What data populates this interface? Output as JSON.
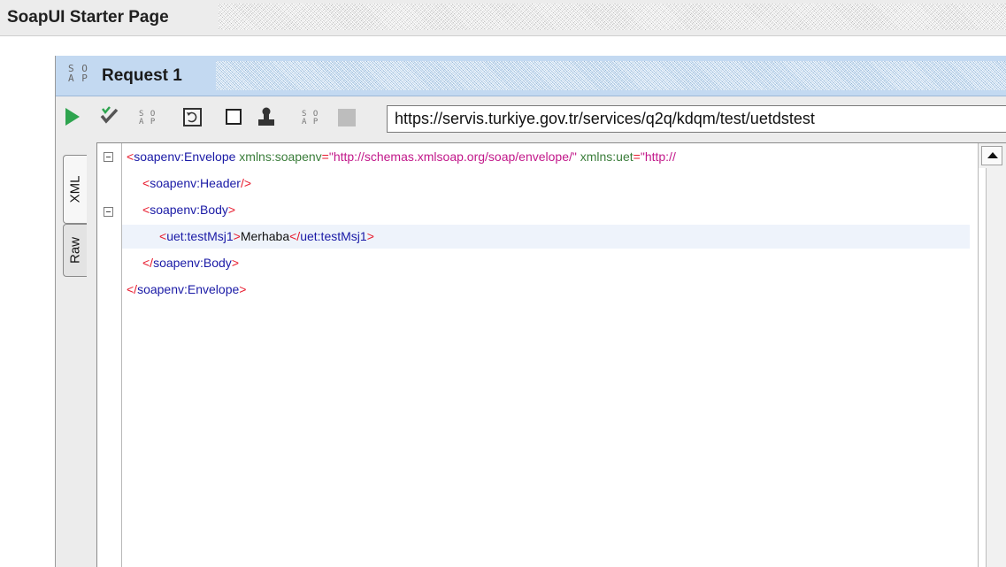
{
  "starter": {
    "title": "SoapUI Starter Page"
  },
  "request": {
    "icon": "soap-icon",
    "title": "Request 1",
    "url": "https://servis.turkiye.gov.tr/services/q2q/kdqm/test/uetdstest"
  },
  "toolbar": {
    "icons": [
      "run-icon",
      "validate-icon",
      "soap-icon",
      "refresh-icon",
      "square-icon",
      "stamp-icon",
      "soap-icon",
      "stop-icon"
    ],
    "accent": "#2ea44f"
  },
  "side_tabs": {
    "xml": "XML",
    "raw": "Raw"
  },
  "editor": {
    "line1": {
      "open": "<",
      "tag": "soapenv:Envelope",
      "attr1": "xmlns:soapenv",
      "eq1": "=",
      "val1": "\"http://schemas.xmlsoap.org/soap/envelope/\"",
      "attr2": "xmlns:uet",
      "eq2": "=",
      "val2": "\"http://"
    },
    "line2": {
      "open": "<",
      "tag": "soapenv:Header",
      "close": "/>"
    },
    "line3": {
      "open": "<",
      "tag": "soapenv:Body",
      "close": ">"
    },
    "line4": {
      "open": "<",
      "tag": "uet:testMsj1",
      "close": ">",
      "text": "Merhaba",
      "open2": "</",
      "tag2": "uet:testMsj1",
      "close2": ">"
    },
    "line5": {
      "open": "</",
      "tag": "soapenv:Body",
      "close": ">"
    },
    "line6": {
      "open": "</",
      "tag": "soapenv:Envelope",
      "close": ">"
    }
  }
}
